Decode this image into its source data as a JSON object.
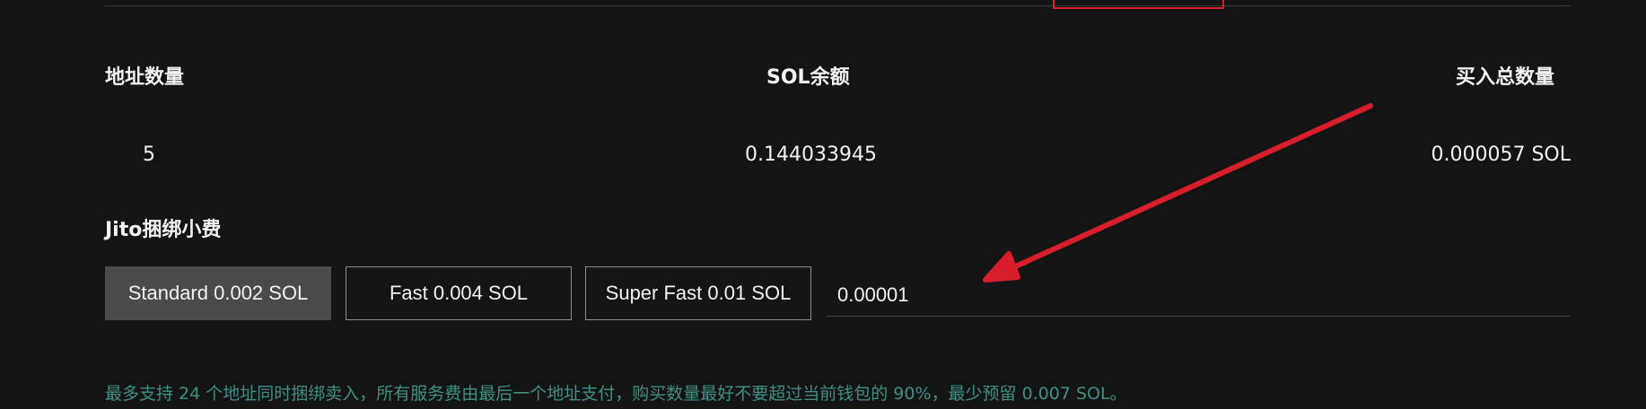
{
  "summary": {
    "address_count_label": "地址数量",
    "sol_balance_label": "SOL余额",
    "total_buy_label": "买入总数量",
    "address_count_value": "5",
    "sol_balance_value": "0.144033945",
    "total_buy_value": "0.000057 SOL"
  },
  "jito": {
    "label": "Jito捆绑小费",
    "options": [
      {
        "label": "Standard 0.002 SOL",
        "selected": true
      },
      {
        "label": "Fast 0.004 SOL",
        "selected": false
      },
      {
        "label": "Super Fast 0.01 SOL",
        "selected": false
      }
    ],
    "custom_value": "0.00001"
  },
  "note": "最多支持 24 个地址同时捆绑卖入，所有服务费由最后一个地址支付，购买数量最好不要超过当前钱包的 90%，最少预留 0.007 SOL。",
  "colors": {
    "background": "#141414",
    "selected_button": "#4a4a4a",
    "note_text": "#3f8f86",
    "annotation_red": "#d81e2a"
  }
}
